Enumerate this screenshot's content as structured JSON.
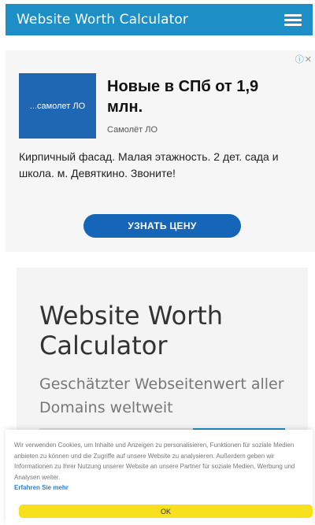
{
  "header": {
    "title": "Website Worth Calculator",
    "menu_icon": "hamburger-menu-icon",
    "background": "#1e8fc6"
  },
  "ad": {
    "adchoices_label": "ⓘ",
    "close_label": "✕",
    "logo_text": "...самолет ЛО",
    "headline": "Новые в СПб от 1,9 млн.",
    "advertiser": "Самолёт ЛО",
    "body": "Кирпичный фасад. Малая этажность. 2 дет. сада и школа. м. Девяткино. Звоните!",
    "cta": "УЗНАТЬ ЦЕНУ"
  },
  "hero": {
    "title": "Website Worth Calculator",
    "subtitle": "Geschätzter Webseitenwert aller Domains weltweit"
  },
  "cookie": {
    "text": "Wir verwenden Cookies, um Inhalte und Anzeigen zu personalisieren, Funktionen für soziale Medien anbieten zu können und die Zugriffe auf unsere Website zu analysieren. Außerdem geben wir Informationen zu Ihrer Nutzung unserer Website an unsere Partner für soziale Medien, Werbung und Analysen weiter.",
    "more_link": "Erfahren Sie mehr",
    "ok_button": "OK"
  }
}
